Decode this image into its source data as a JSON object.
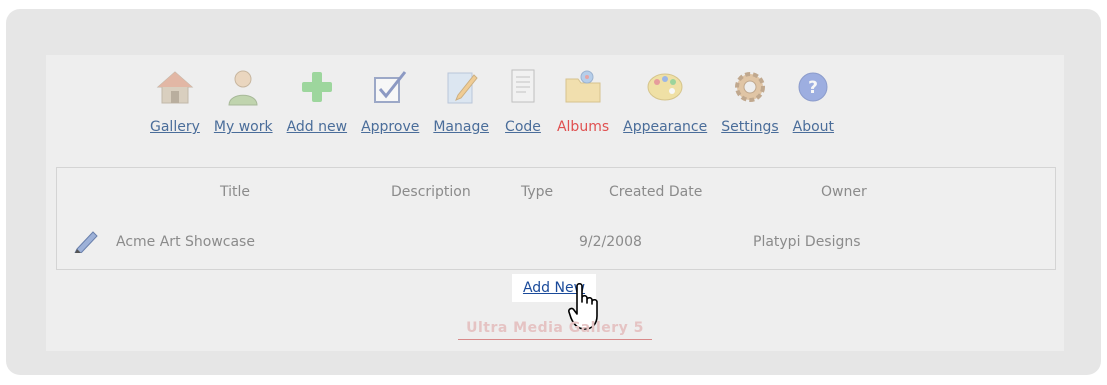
{
  "toolbar": {
    "items": [
      {
        "label": "Gallery",
        "icon": "house-icon"
      },
      {
        "label": "My work",
        "icon": "user-icon"
      },
      {
        "label": "Add new",
        "icon": "plus-icon"
      },
      {
        "label": "Approve",
        "icon": "checkbox-icon"
      },
      {
        "label": "Manage",
        "icon": "edit-document-icon"
      },
      {
        "label": "Code",
        "icon": "code-document-icon"
      },
      {
        "label": "Albums",
        "icon": "album-folder-icon"
      },
      {
        "label": "Appearance",
        "icon": "palette-icon"
      },
      {
        "label": "Settings",
        "icon": "gear-icon"
      },
      {
        "label": "About",
        "icon": "help-icon"
      }
    ],
    "active_item": "Albums",
    "active_color": "#e05050"
  },
  "table": {
    "headers": {
      "title": "Title",
      "description": "Description",
      "type": "Type",
      "created_date": "Created Date",
      "owner": "Owner"
    },
    "rows": [
      {
        "title": "Acme Art Showcase",
        "description": "",
        "type": "",
        "created_date": "9/2/2008",
        "owner": "Platypi Designs"
      }
    ]
  },
  "add_new_label": "Add New",
  "footer_text": "Ultra Media Gallery 5"
}
